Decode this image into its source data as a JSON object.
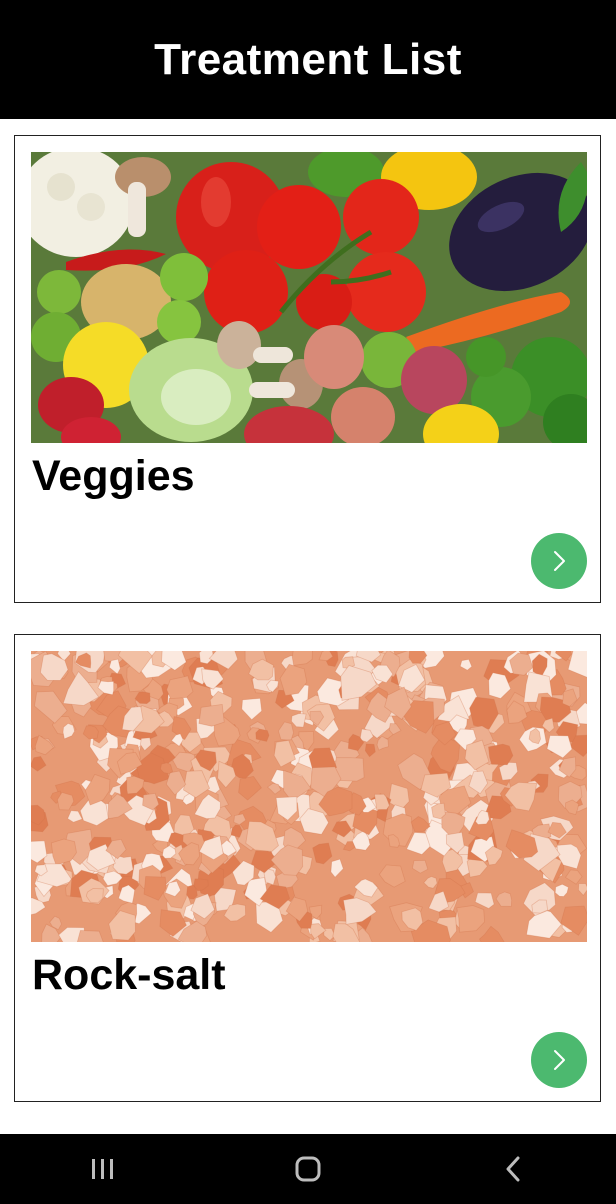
{
  "header": {
    "title": "Treatment List"
  },
  "items": [
    {
      "title": "Veggies",
      "image_icon": "vegetables-photo",
      "action_icon": "chevron-right-icon"
    },
    {
      "title": "Rock-salt",
      "image_icon": "rock-salt-photo",
      "action_icon": "chevron-right-icon"
    }
  ],
  "navbar": {
    "recents_icon": "recents-icon",
    "home_icon": "home-icon",
    "back_icon": "back-icon"
  },
  "colors": {
    "header_bg": "#000000",
    "accent_button": "#4cb96f"
  }
}
